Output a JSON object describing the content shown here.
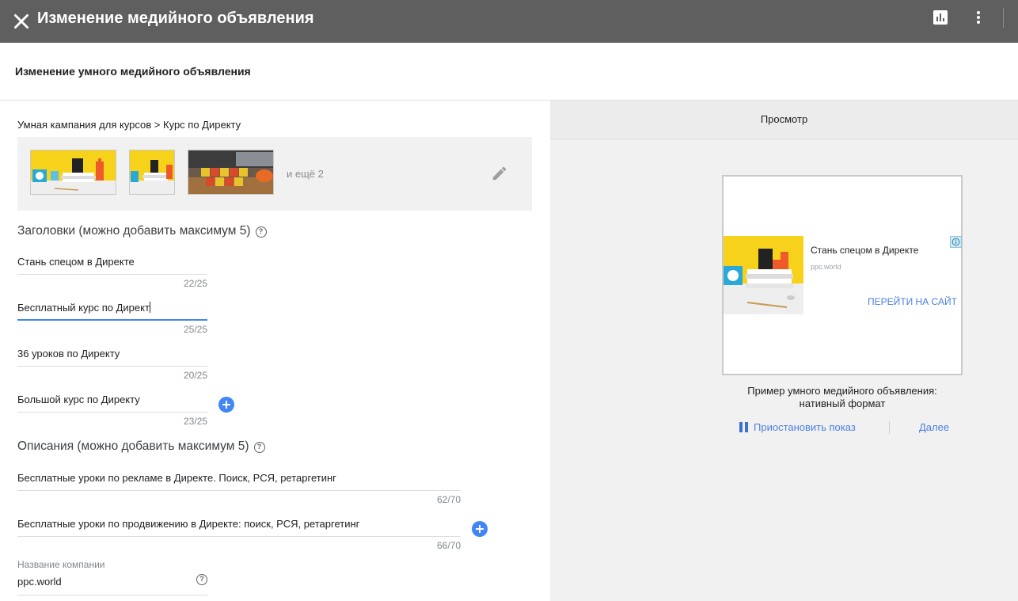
{
  "topbar": {
    "title": "Изменение медийного объявления"
  },
  "subheader": {
    "title": "Изменение умного медийного объявления"
  },
  "left": {
    "breadcrumb": "Умная кампания для курсов > Курс по Директу",
    "images_more": "и ещё 2",
    "headlines_title": "Заголовки (можно добавить максимум 5)",
    "headlines": [
      {
        "value": "Стань спецом в Директе",
        "count": "22/25"
      },
      {
        "value": "Бесплатный курс по Директ",
        "count": "25/25"
      },
      {
        "value": "36 уроков по Директу",
        "count": "20/25"
      },
      {
        "value": "Большой курс по Директу",
        "count": "23/25"
      }
    ],
    "descriptions_title": "Описания (можно добавить максимум 5)",
    "descriptions": [
      {
        "value": "Бесплатные уроки по рекламе в Директе. Поиск, РСЯ, ретаргетинг",
        "count": "62/70"
      },
      {
        "value": "Бесплатные уроки по продвижению в Директе: поиск, РСЯ, ретаргетинг",
        "count": "66/70"
      }
    ],
    "company_label": "Название компании",
    "company_value": "ppc.world"
  },
  "right": {
    "tab": "Просмотр",
    "ad_title": "Стань спецом в Директе",
    "ad_site": "ppc.world",
    "ad_cta": "ПЕРЕЙТИ НА САЙТ",
    "caption_line1": "Пример умного медийного объявления:",
    "caption_line2": "нативный формат",
    "pause_label": "Приостановить показ",
    "next_label": "Далее"
  },
  "colors": {
    "topbar": "#5f5f5f",
    "accent": "#4285f4",
    "link": "#4a7fe0"
  }
}
